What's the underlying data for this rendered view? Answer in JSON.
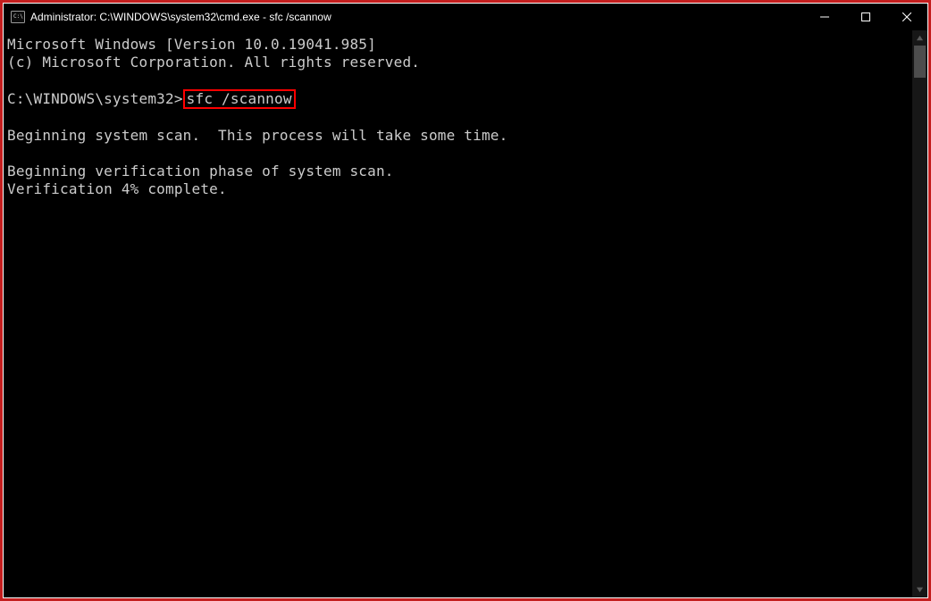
{
  "window": {
    "title": "Administrator: C:\\WINDOWS\\system32\\cmd.exe - sfc  /scannow"
  },
  "terminal": {
    "line1": "Microsoft Windows [Version 10.0.19041.985]",
    "line2": "(c) Microsoft Corporation. All rights reserved.",
    "blank": "",
    "prompt_prefix": "C:\\WINDOWS\\system32>",
    "command": "sfc /scannow",
    "line4": "Beginning system scan.  This process will take some time.",
    "line5": "Beginning verification phase of system scan.",
    "line6": "Verification 4% complete."
  }
}
